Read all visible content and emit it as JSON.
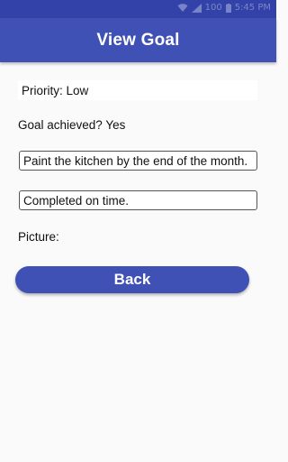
{
  "status_bar": {
    "time": "5:45 PM",
    "battery": "100"
  },
  "app_bar": {
    "title": "View Goal"
  },
  "goal": {
    "priority_text": "Priority: Low",
    "achieved_text": "Goal achieved? Yes",
    "description_value": "Paint the kitchen by the end of the month.",
    "notes_value": "Completed on time.",
    "picture_label": "Picture:"
  },
  "actions": {
    "back_label": "Back"
  },
  "colors": {
    "primary": "#3f51b5",
    "primary_dark": "#3242a8",
    "background": "#fafafa"
  }
}
